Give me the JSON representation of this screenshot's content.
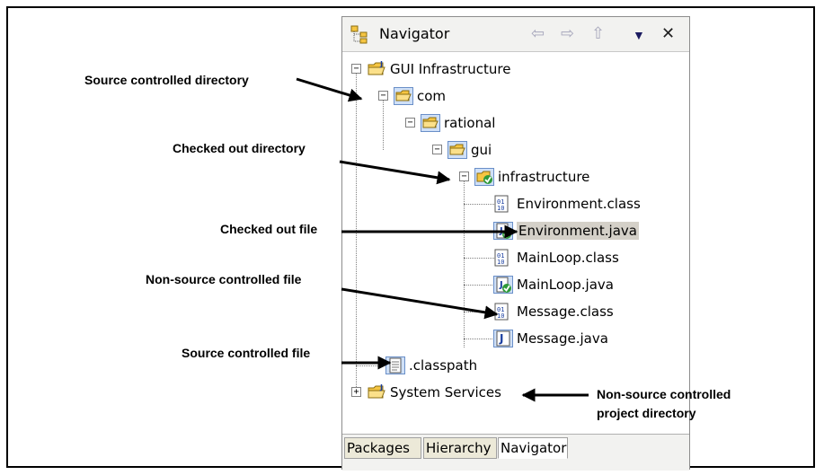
{
  "navigator": {
    "title": "Navigator",
    "toolbar": {
      "back_icon": "back-arrow-icon",
      "forward_icon": "forward-arrow-icon",
      "up_icon": "up-arrow-icon",
      "menu_icon": "view-menu-icon",
      "close_icon": "close-icon"
    },
    "tree": [
      {
        "label": "GUI Infrastructure",
        "icon": "project-folder-icon",
        "expander": "−"
      },
      {
        "label": "com",
        "icon": "folder-icon",
        "expander": "−"
      },
      {
        "label": "rational",
        "icon": "folder-icon",
        "expander": "−"
      },
      {
        "label": "gui",
        "icon": "folder-icon",
        "expander": "−"
      },
      {
        "label": "infrastructure",
        "icon": "checked-out-folder-icon",
        "expander": "−"
      },
      {
        "label": "Environment.class",
        "icon": "class-file-icon"
      },
      {
        "label": "Environment.java",
        "icon": "checked-out-java-file-icon",
        "selected": true
      },
      {
        "label": "MainLoop.class",
        "icon": "class-file-icon"
      },
      {
        "label": "MainLoop.java",
        "icon": "checked-out-java-file-icon"
      },
      {
        "label": "Message.class",
        "icon": "class-file-icon"
      },
      {
        "label": "Message.java",
        "icon": "java-file-icon"
      },
      {
        "label": ".classpath",
        "icon": "text-file-icon"
      },
      {
        "label": "System Services",
        "icon": "project-folder-icon",
        "expander": "+"
      }
    ],
    "tabs": [
      "Packages",
      "Hierarchy",
      "Navigator"
    ],
    "active_tab": "Navigator"
  },
  "callouts": {
    "source_dir": "Source controlled directory",
    "checked_out_dir": "Checked out directory",
    "checked_out_file": "Checked out file",
    "non_source_file": "Non-source controlled file",
    "source_file": "Source controlled file",
    "non_source_project_line1": "Non-source controlled",
    "non_source_project_line2": "project directory"
  },
  "colors": {
    "folder": "#f5c542",
    "check": "#2e9a3a",
    "selection": "#d4d0c8",
    "toolbar_disabled": "#a8a8bc"
  }
}
